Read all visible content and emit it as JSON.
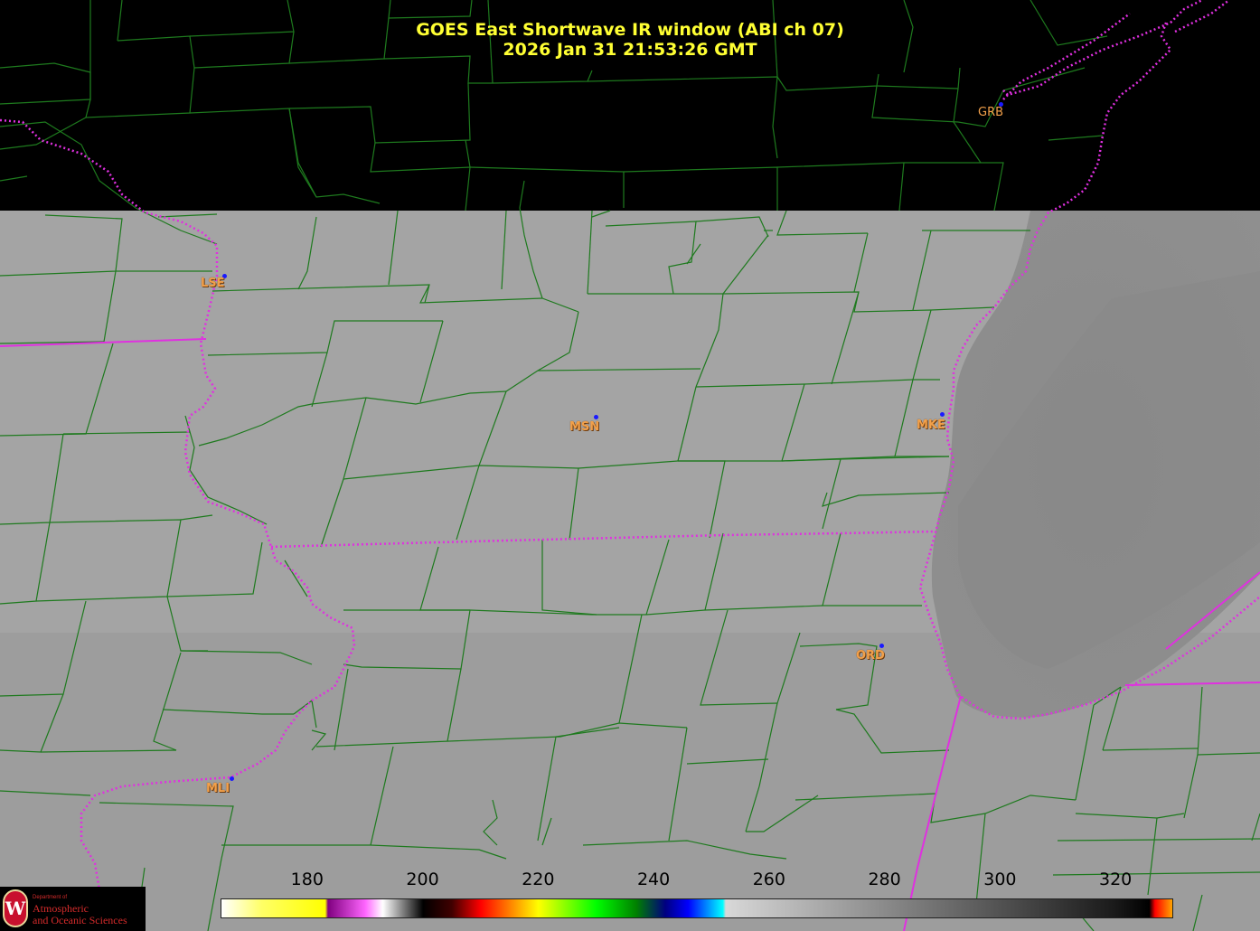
{
  "title": {
    "line1": "GOES East Shortwave IR window (ABI ch 07)",
    "line2": "2026 Jan 31  21:53:26 GMT"
  },
  "colors": {
    "title": "#ffff33",
    "county_lines": "#1e7a1e",
    "state_lines": "#e030e0",
    "station_labels": "#f2a04a",
    "station_dots": "#1a1aff",
    "no_data": "#000000",
    "surface": "#a5a5a5",
    "lake": "#8c8c8c"
  },
  "stations": [
    {
      "id": "GRB"
    },
    {
      "id": "LSE"
    },
    {
      "id": "MSN"
    },
    {
      "id": "MKE"
    },
    {
      "id": "ORD"
    },
    {
      "id": "MLI"
    }
  ],
  "colorbar": {
    "units_min": 165,
    "units_max": 330,
    "tick_labels": [
      "180",
      "200",
      "220",
      "240",
      "260",
      "280",
      "300",
      "320"
    ],
    "tick_values": [
      180,
      200,
      220,
      240,
      260,
      280,
      300,
      320
    ],
    "stops": [
      {
        "value": 165,
        "color": "#ffffff"
      },
      {
        "value": 172,
        "color": "#ffff66"
      },
      {
        "value": 183,
        "color": "#ffff00"
      },
      {
        "value": 183.5,
        "color": "#800080"
      },
      {
        "value": 190,
        "color": "#ff66ff"
      },
      {
        "value": 193,
        "color": "#ffffff"
      },
      {
        "value": 200,
        "color": "#000000"
      },
      {
        "value": 205,
        "color": "#400000"
      },
      {
        "value": 210,
        "color": "#ff0000"
      },
      {
        "value": 215,
        "color": "#ff8000"
      },
      {
        "value": 220,
        "color": "#ffff00"
      },
      {
        "value": 230,
        "color": "#00ff00"
      },
      {
        "value": 237,
        "color": "#008000"
      },
      {
        "value": 242,
        "color": "#000080"
      },
      {
        "value": 246,
        "color": "#0000ff"
      },
      {
        "value": 252,
        "color": "#00ffff"
      },
      {
        "value": 252.5,
        "color": "#d8d8d8"
      },
      {
        "value": 320,
        "color": "#1a1a1a"
      },
      {
        "value": 326,
        "color": "#000000"
      },
      {
        "value": 327,
        "color": "#ff0000"
      },
      {
        "value": 330,
        "color": "#ffa500"
      }
    ]
  },
  "logo": {
    "emblem": "W",
    "dept_line": "Department of",
    "name_line1": "Atmospheric",
    "name_line2": "and Oceanic Sciences"
  }
}
